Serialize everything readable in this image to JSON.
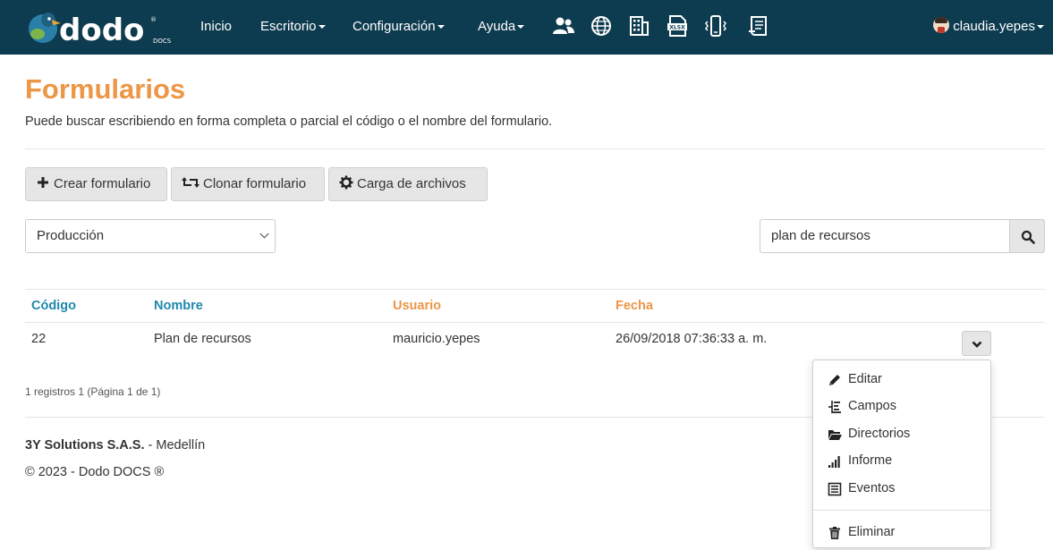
{
  "navbar": {
    "logo_text": "dodo",
    "logo_sub": "DOCS",
    "items": [
      {
        "label": "Inicio",
        "has_caret": false
      },
      {
        "label": "Escritorio",
        "has_caret": true
      },
      {
        "label": "Configuración",
        "has_caret": true
      },
      {
        "label": "Ayuda",
        "has_caret": true
      }
    ],
    "icons": [
      "users-icon",
      "globe-icon",
      "building-icon",
      "xlsx-icon",
      "mobile-icon",
      "report-icon"
    ],
    "xlsx_label": "XLSX",
    "user": "claudia.yepes"
  },
  "page": {
    "title": "Formularios",
    "description": "Puede buscar escribiendo en forma completa o parcial el código o el nombre del formulario."
  },
  "toolbar": {
    "create_label": "Crear formulario",
    "clone_label": "Clonar formulario",
    "upload_label": "Carga de archivos"
  },
  "filters": {
    "environment_selected": "Producción",
    "search_value": "plan de recursos"
  },
  "table": {
    "headers": {
      "codigo": "Código",
      "nombre": "Nombre",
      "usuario": "Usuario",
      "fecha": "Fecha"
    },
    "rows": [
      {
        "codigo": "22",
        "nombre": "Plan de recursos",
        "usuario": "mauricio.yepes",
        "fecha": "26/09/2018 07:36:33 a. m."
      }
    ]
  },
  "pager_text": "1 registros 1 (Página 1 de 1)",
  "row_menu": {
    "items": [
      {
        "label": "Editar",
        "icon": "pencil-icon"
      },
      {
        "label": "Campos",
        "icon": "fields-icon"
      },
      {
        "label": "Directorios",
        "icon": "folder-open-icon"
      },
      {
        "label": "Informe",
        "icon": "signal-icon"
      },
      {
        "label": "Eventos",
        "icon": "list-icon"
      }
    ],
    "delete_label": "Eliminar"
  },
  "footer": {
    "company": "3Y Solutions S.A.S.",
    "city": " - Medellín",
    "copyright": "© 2023 - Dodo DOCS ®"
  },
  "colors": {
    "navbar": "#0d3b4f",
    "title": "#ec9646",
    "header_teal": "#1e88ad",
    "header_orange": "#ec9646"
  }
}
